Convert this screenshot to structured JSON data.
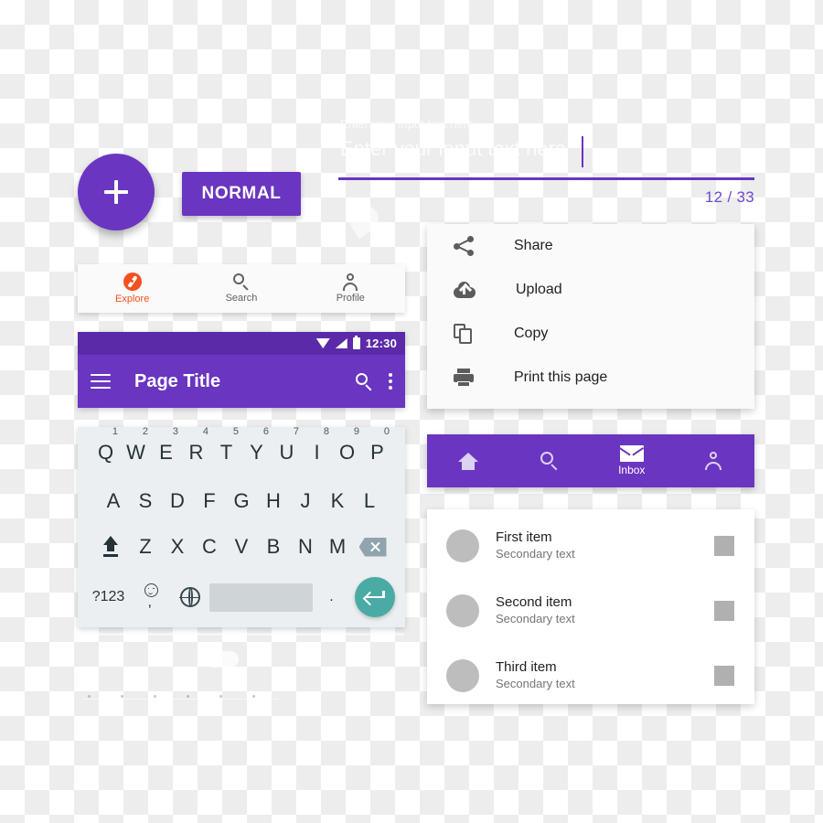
{
  "theme": {
    "purple": "#6a35c0",
    "purple_dark": "#5a2aa8",
    "purple_text": "#6f49cf",
    "orange": "#f4511e",
    "teal": "#4aaba4",
    "keyboard_bg": "#eceff1"
  },
  "fab": {
    "icon": "plus-icon",
    "label": ""
  },
  "normal_button": {
    "label": "NORMAL"
  },
  "textfield": {
    "label": "Enter your input text here",
    "value": "Enter your input text here",
    "counter": "12 / 33"
  },
  "tabbar": {
    "tabs": [
      {
        "label": "Explore",
        "icon": "compass-icon",
        "active": true
      },
      {
        "label": "Search",
        "icon": "search-icon",
        "active": false
      },
      {
        "label": "Profile",
        "icon": "person-icon",
        "active": false
      }
    ]
  },
  "appbar": {
    "status": {
      "clock": "12:30",
      "icons": [
        "wifi-icon",
        "signal-icon",
        "battery-icon"
      ]
    },
    "menu_icon": "hamburger-menu-icon",
    "title": "Page Title",
    "search_icon": "search-icon",
    "more_icon": "overflow-menu-icon"
  },
  "keyboard": {
    "row1": [
      {
        "letter": "Q",
        "num": "1"
      },
      {
        "letter": "W",
        "num": "2"
      },
      {
        "letter": "E",
        "num": "3"
      },
      {
        "letter": "R",
        "num": "4"
      },
      {
        "letter": "T",
        "num": "5"
      },
      {
        "letter": "Y",
        "num": "6"
      },
      {
        "letter": "U",
        "num": "7"
      },
      {
        "letter": "I",
        "num": "8"
      },
      {
        "letter": "O",
        "num": "9"
      },
      {
        "letter": "P",
        "num": "0"
      }
    ],
    "row2": [
      "A",
      "S",
      "D",
      "F",
      "G",
      "H",
      "J",
      "K",
      "L"
    ],
    "row3": [
      "Z",
      "X",
      "C",
      "V",
      "B",
      "N",
      "M"
    ],
    "shift_icon": "shift-icon",
    "backspace_icon": "backspace-icon",
    "symbols_key": "?123",
    "comma_key": ",",
    "emoji_icon": "emoji-icon",
    "globe_icon": "globe-language-icon",
    "space_key": "",
    "period_key": ".",
    "enter_icon": "enter-return-icon"
  },
  "menucard": {
    "items": [
      {
        "label": "Share",
        "icon": "share-icon"
      },
      {
        "label": "Upload",
        "icon": "cloud-upload-icon"
      },
      {
        "label": "Copy",
        "icon": "copy-icon"
      },
      {
        "label": "Print this page",
        "icon": "print-icon"
      }
    ]
  },
  "bottomnav": {
    "items": [
      {
        "label": "",
        "icon": "home-icon",
        "active": false
      },
      {
        "label": "",
        "icon": "search-icon",
        "active": false
      },
      {
        "label": "Inbox",
        "icon": "mail-icon",
        "active": true
      },
      {
        "label": "",
        "icon": "person-icon",
        "active": false
      }
    ]
  },
  "listcard": {
    "rows": [
      {
        "primary": "First item",
        "secondary": "Secondary text"
      },
      {
        "primary": "Second item",
        "secondary": "Secondary text"
      },
      {
        "primary": "Third item",
        "secondary": "Secondary text"
      }
    ]
  }
}
